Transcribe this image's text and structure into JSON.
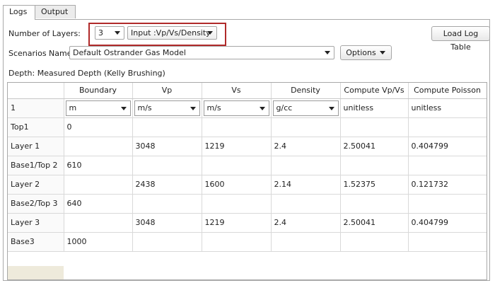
{
  "tabs": [
    "Logs",
    "Output"
  ],
  "layers": {
    "label": "Number of Layers:",
    "value": "3",
    "input_mode": "Input :Vp/Vs/Density"
  },
  "load_button": "Load Log Table",
  "scenario": {
    "label": "Scenarios Name:",
    "value": "Default Ostrander Gas Model",
    "options_label": "Options"
  },
  "depth_label": "Depth: Measured Depth (Kelly Brushing)",
  "highlight_color": "#b02a2a",
  "table": {
    "columns": [
      "",
      "Boundary",
      "Vp",
      "Vs",
      "Density",
      "Compute Vp/Vs",
      "Compute Poisson"
    ],
    "units_row": {
      "label": "1",
      "boundary": "m",
      "vp": "m/s",
      "vs": "m/s",
      "density": "g/cc",
      "vpvs": "unitless",
      "poisson": "unitless"
    },
    "rows": [
      {
        "name": "Top1",
        "boundary": "0",
        "vp": "",
        "vs": "",
        "density": "",
        "vpvs": "",
        "poisson": ""
      },
      {
        "name": "Layer 1",
        "boundary": "",
        "vp": "3048",
        "vs": "1219",
        "density": "2.4",
        "vpvs": "2.50041",
        "poisson": "0.404799"
      },
      {
        "name": "Base1/Top 2",
        "boundary": "610",
        "vp": "",
        "vs": "",
        "density": "",
        "vpvs": "",
        "poisson": ""
      },
      {
        "name": "Layer 2",
        "boundary": "",
        "vp": "2438",
        "vs": "1600",
        "density": "2.14",
        "vpvs": "1.52375",
        "poisson": "0.121732"
      },
      {
        "name": "Base2/Top 3",
        "boundary": "640",
        "vp": "",
        "vs": "",
        "density": "",
        "vpvs": "",
        "poisson": ""
      },
      {
        "name": "Layer 3",
        "boundary": "",
        "vp": "3048",
        "vs": "1219",
        "density": "2.4",
        "vpvs": "2.50041",
        "poisson": "0.404799"
      },
      {
        "name": "Base3",
        "boundary": "1000",
        "vp": "",
        "vs": "",
        "density": "",
        "vpvs": "",
        "poisson": ""
      }
    ]
  }
}
